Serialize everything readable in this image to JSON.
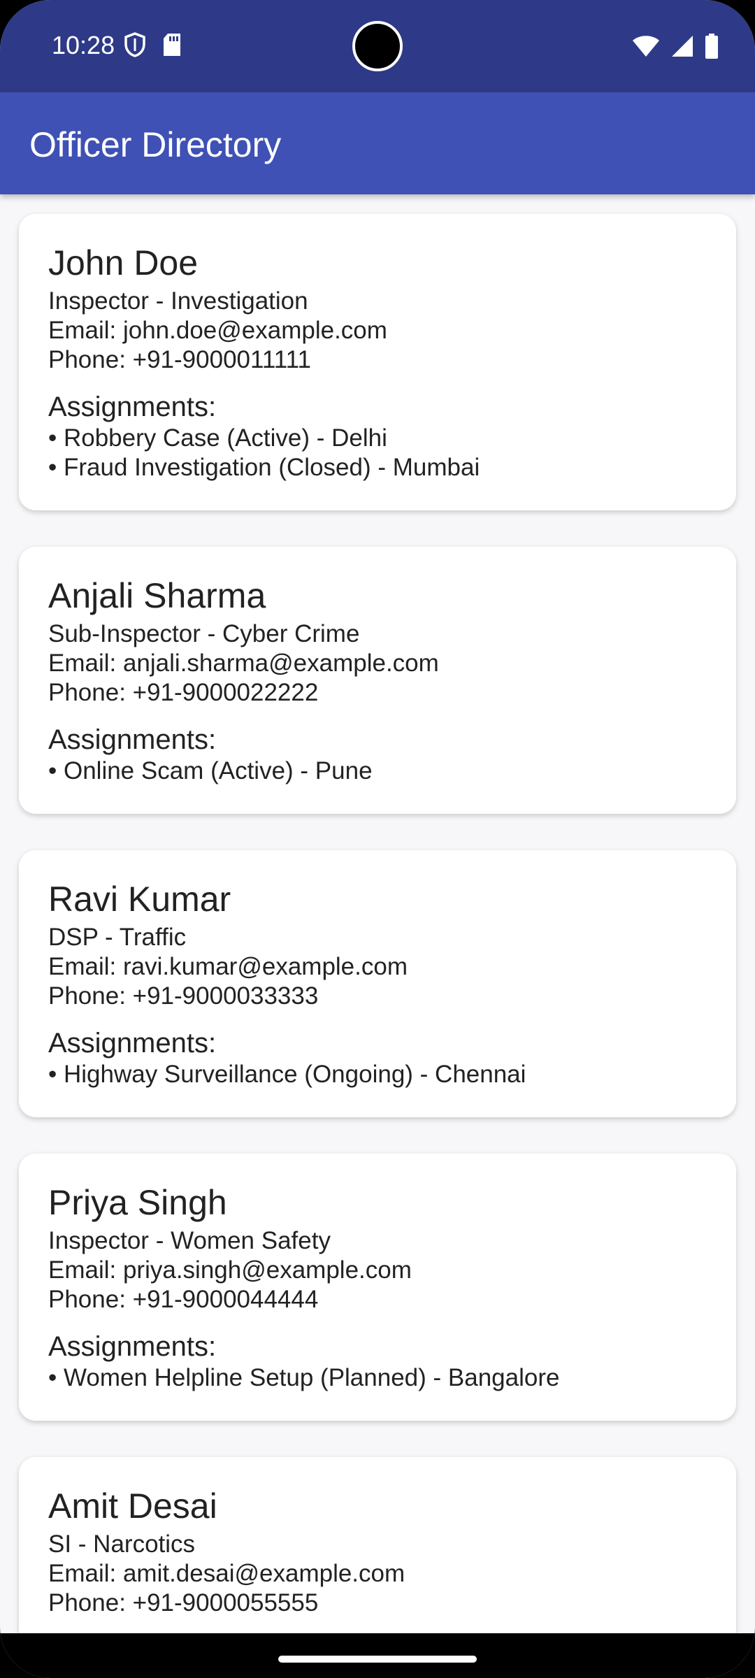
{
  "status_bar": {
    "time": "10:28",
    "icons_left": [
      "shield-icon",
      "sd-card-icon"
    ],
    "icons_right": [
      "wifi-icon",
      "signal-icon",
      "battery-icon"
    ]
  },
  "app_bar": {
    "title": "Officer Directory",
    "color": "#3f51b5"
  },
  "officers": [
    {
      "name": "John Doe",
      "role": "Inspector - Investigation",
      "email": "Email: john.doe@example.com",
      "phone": "Phone: +91-9000011111",
      "assignments_label": "Assignments:",
      "assignments": [
        "• Robbery Case (Active) - Delhi",
        "• Fraud Investigation (Closed) - Mumbai"
      ]
    },
    {
      "name": "Anjali Sharma",
      "role": "Sub-Inspector - Cyber Crime",
      "email": "Email: anjali.sharma@example.com",
      "phone": "Phone: +91-9000022222",
      "assignments_label": "Assignments:",
      "assignments": [
        "• Online Scam (Active) - Pune"
      ]
    },
    {
      "name": "Ravi Kumar",
      "role": "DSP - Traffic",
      "email": "Email: ravi.kumar@example.com",
      "phone": "Phone: +91-9000033333",
      "assignments_label": "Assignments:",
      "assignments": [
        "• Highway Surveillance (Ongoing) - Chennai"
      ]
    },
    {
      "name": "Priya Singh",
      "role": "Inspector - Women Safety",
      "email": "Email: priya.singh@example.com",
      "phone": "Phone: +91-9000044444",
      "assignments_label": "Assignments:",
      "assignments": [
        "• Women Helpline Setup (Planned) - Bangalore"
      ]
    },
    {
      "name": "Amit Desai",
      "role": "SI - Narcotics",
      "email": "Email: amit.desai@example.com",
      "phone": "Phone: +91-9000055555",
      "assignments_label": "",
      "assignments": []
    }
  ]
}
